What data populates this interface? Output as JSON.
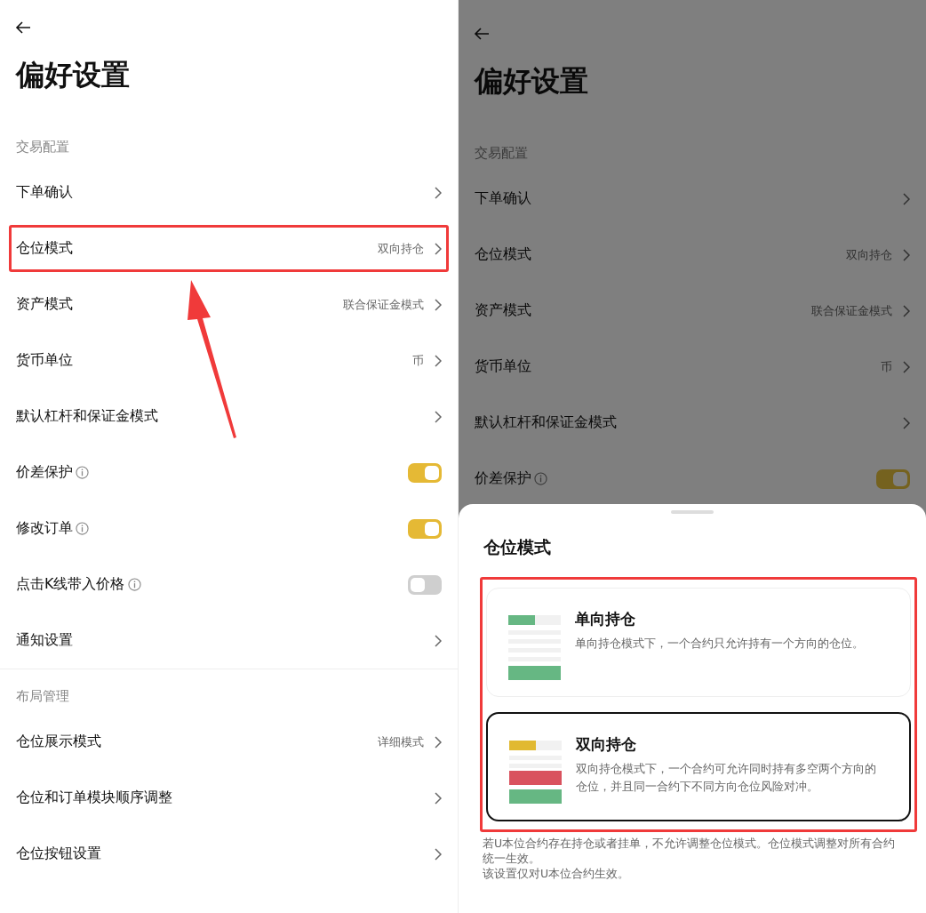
{
  "left_screen": {
    "title": "偏好设置",
    "sections": [
      {
        "heading": "交易配置",
        "rows": [
          {
            "kind": "link",
            "label": "下单确认",
            "highlighted": false
          },
          {
            "kind": "link",
            "label": "仓位模式",
            "value": "双向持仓",
            "highlighted": true
          },
          {
            "kind": "link",
            "label": "资产模式",
            "value": "联合保证金模式",
            "highlighted": false
          },
          {
            "kind": "link",
            "label": "货币单位",
            "value": "币",
            "highlighted": false
          },
          {
            "kind": "link",
            "label": "默认杠杆和保证金模式",
            "highlighted": false
          },
          {
            "kind": "toggle",
            "label": "价差保护",
            "info": true,
            "on": true,
            "highlighted": false
          },
          {
            "kind": "toggle",
            "label": "修改订单",
            "info": true,
            "on": true,
            "highlighted": false
          },
          {
            "kind": "toggle",
            "label": "点击K线带入价格",
            "info": true,
            "on": false,
            "highlighted": false
          },
          {
            "kind": "link",
            "label": "通知设置",
            "highlighted": false
          }
        ]
      },
      {
        "heading": "布局管理",
        "rows": [
          {
            "kind": "link",
            "label": "仓位展示模式",
            "value": "详细模式",
            "highlighted": false
          },
          {
            "kind": "link",
            "label": "仓位和订单模块顺序调整",
            "highlighted": false
          },
          {
            "kind": "link",
            "label": "仓位按钮设置",
            "highlighted": false
          }
        ]
      }
    ]
  },
  "right_screen": {
    "title": "偏好设置",
    "sections": [
      {
        "heading": "交易配置",
        "rows": [
          {
            "kind": "link",
            "label": "下单确认",
            "highlighted": false
          },
          {
            "kind": "link",
            "label": "仓位模式",
            "value": "双向持仓",
            "highlighted": false
          },
          {
            "kind": "link",
            "label": "资产模式",
            "value": "联合保证金模式",
            "highlighted": false
          },
          {
            "kind": "link",
            "label": "货币单位",
            "value": "币",
            "highlighted": false
          },
          {
            "kind": "link",
            "label": "默认杠杆和保证金模式",
            "highlighted": false
          },
          {
            "kind": "toggle",
            "label": "价差保护",
            "info": true,
            "on": true,
            "highlighted": false
          }
        ]
      }
    ],
    "sheet": {
      "title": "仓位模式",
      "options_highlighted": true,
      "options": [
        {
          "kind": "single",
          "title": "单向持仓",
          "description": "单向持仓模式下，一个合约只允许持有一个方向的仓位。",
          "selected": false
        },
        {
          "kind": "dual",
          "title": "双向持仓",
          "description": "双向持仓模式下，一个合约可允许同时持有多空两个方向的仓位，并且同一合约下不同方向仓位风险对冲。",
          "selected": true
        }
      ],
      "notes": [
        "若U本位合约存在持仓或者挂单，不允许调整仓位模式。仓位模式调整对所有合约统一生效。",
        "该设置仅对U本位合约生效。"
      ]
    }
  }
}
